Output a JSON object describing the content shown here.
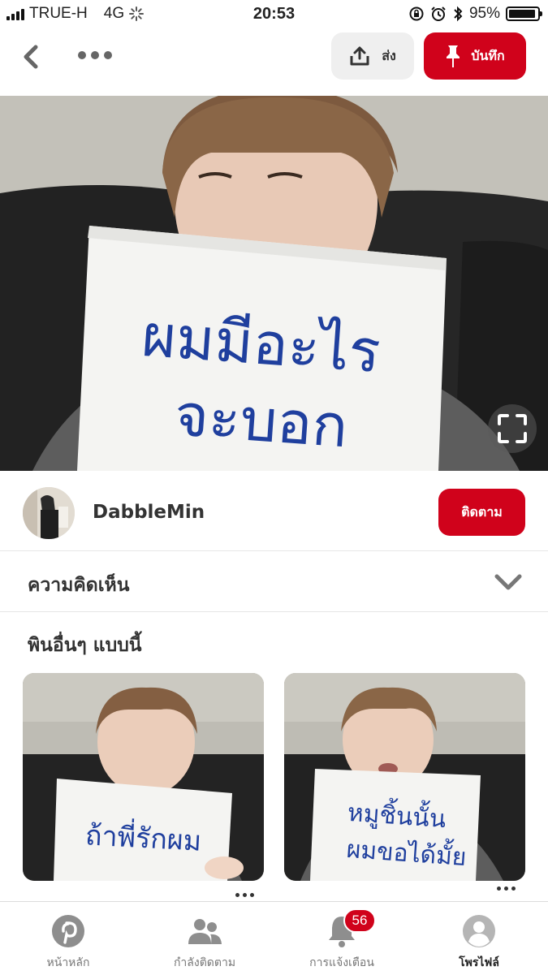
{
  "status_bar": {
    "carrier": "TRUE-H",
    "network": "4G",
    "time": "20:53",
    "battery": "95%",
    "battery_level": 0.95
  },
  "nav": {
    "share_label": "ส่ง",
    "save_label": "บันทึก"
  },
  "hero": {
    "sign_line1": "ผมมีอะไร",
    "sign_line2": "จะบอก"
  },
  "creator": {
    "name": "DabbleMin",
    "follow_label": "ติดตาม"
  },
  "comments": {
    "title": "ความคิดเห็น"
  },
  "more_like_this": {
    "title": "พินอื่นๆ แบบนี้",
    "pins": [
      {
        "sign_text": "ถ้าพี่รักผม"
      },
      {
        "sign_line1": "หมูชิ้นนั้น",
        "sign_line2": "ผมขอได้มั้ย"
      }
    ]
  },
  "tab_bar": {
    "tabs": [
      {
        "label": "หน้าหลัก",
        "icon": "pinterest-icon"
      },
      {
        "label": "กำลังติดตาม",
        "icon": "people-icon"
      },
      {
        "label": "การแจ้งเตือน",
        "icon": "bell-icon",
        "badge": "56"
      },
      {
        "label": "โพรไฟล์",
        "icon": "profile-icon"
      }
    ]
  },
  "colors": {
    "accent": "#d0021b",
    "sign_ink": "#1f3f9e"
  }
}
